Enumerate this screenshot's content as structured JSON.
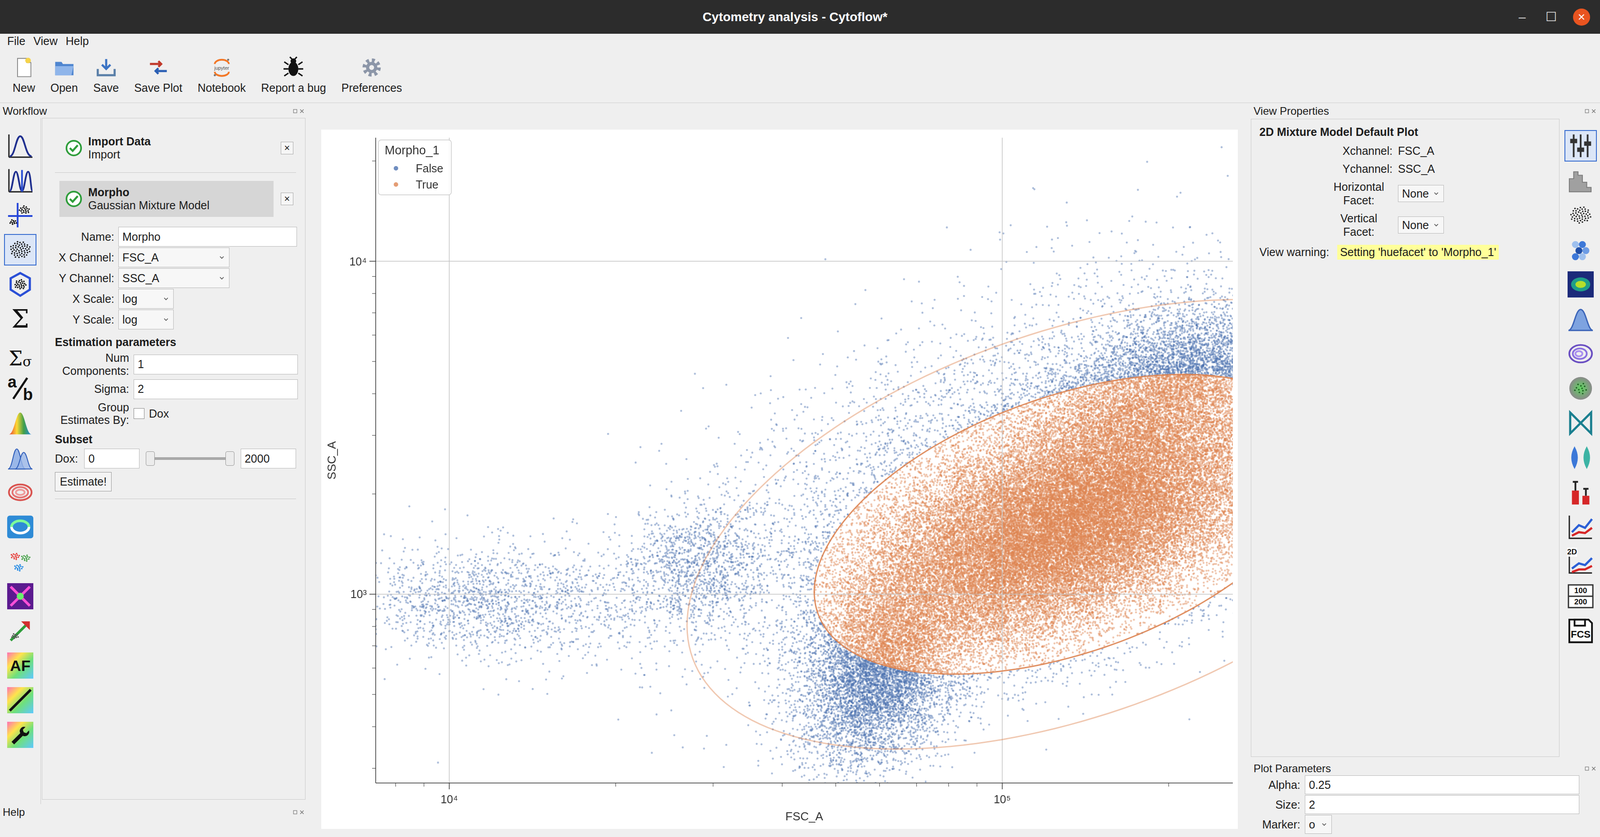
{
  "window": {
    "title": "Cytometry analysis - Cytoflow*",
    "controls": [
      "–",
      "☐",
      "×"
    ]
  },
  "menu": [
    "File",
    "View",
    "Help"
  ],
  "toolbar": [
    {
      "label": "New"
    },
    {
      "label": "Open"
    },
    {
      "label": "Save"
    },
    {
      "label": "Save Plot"
    },
    {
      "label": "Notebook",
      "icon_text": "jupyter"
    },
    {
      "label": "Report a bug"
    },
    {
      "label": "Preferences"
    }
  ],
  "workflow": {
    "title": "Workflow",
    "operations": [
      {
        "selected": false
      },
      {
        "selected": false
      },
      {
        "selected": false
      },
      {
        "selected": true
      },
      {
        "selected": false
      },
      {
        "selected": false,
        "label": "Σ"
      },
      {
        "selected": false,
        "label": "Σ",
        "sub": "σ"
      },
      {
        "selected": false,
        "label": "a",
        "sub": "b"
      },
      {
        "selected": false
      },
      {
        "selected": false
      },
      {
        "selected": false
      },
      {
        "selected": false
      },
      {
        "selected": false
      },
      {
        "selected": false
      },
      {
        "selected": false
      },
      {
        "selected": false,
        "label": "AF"
      },
      {
        "selected": false
      },
      {
        "selected": false
      }
    ],
    "steps": [
      {
        "name": "Import Data",
        "type": "Import",
        "valid": true,
        "selected": false,
        "close": "×"
      },
      {
        "name": "Morpho",
        "type": "Gaussian Mixture Model",
        "valid": true,
        "selected": true,
        "close": "×"
      }
    ],
    "form": {
      "fields": [
        {
          "label": "Name:",
          "value": "Morpho",
          "kind": "text"
        },
        {
          "label": "X Channel:",
          "value": "FSC_A",
          "kind": "select"
        },
        {
          "label": "Y Channel:",
          "value": "SSC_A",
          "kind": "select"
        },
        {
          "label": "X Scale:",
          "value": "log",
          "kind": "select"
        },
        {
          "label": "Y Scale:",
          "value": "log",
          "kind": "select"
        }
      ],
      "estimation": {
        "title": "Estimation parameters",
        "fields": [
          {
            "label": "Num Components:",
            "value": "1",
            "kind": "text"
          },
          {
            "label": "Sigma:",
            "value": "2",
            "kind": "text"
          },
          {
            "label": "Group Estimates By:",
            "kind": "checkbox",
            "options": [
              {
                "label": "Dox",
                "checked": false
              }
            ]
          }
        ]
      },
      "subset": {
        "title": "Subset",
        "ranges": [
          {
            "label": "Dox:",
            "low": "0",
            "high": "2000",
            "low_level": 0,
            "high_level": 1
          }
        ]
      },
      "button": "Estimate!"
    }
  },
  "help": {
    "title": "Help"
  },
  "plot": {
    "x_axis": {
      "label": "FSC_A",
      "scale": "log",
      "min": 3.867,
      "max": 5.417,
      "ticks": [
        {
          "value": 4,
          "label": "10⁴"
        },
        {
          "value": 5,
          "label": "10⁵"
        }
      ]
    },
    "y_axis": {
      "label": "SSC_A",
      "scale": "log",
      "min": 2.433,
      "max": 4.371,
      "ticks": [
        {
          "value": 3,
          "label": "10³"
        },
        {
          "value": 4,
          "label": "10⁴"
        }
      ]
    },
    "legend": {
      "title": "Morpho_1",
      "items": [
        {
          "label": "False",
          "color": "#4c72b0"
        },
        {
          "label": "True",
          "color": "#dd8452"
        }
      ]
    },
    "populations": [
      {
        "center": [
          5.12,
          3.21
        ],
        "sd": [
          0.19,
          0.19
        ],
        "rho": 0.55,
        "count": 42000
      },
      {
        "center": [
          5.3,
          3.62
        ],
        "sd": [
          0.12,
          0.13
        ],
        "rho": 0.5,
        "count": 7000
      },
      {
        "center": [
          4.78,
          2.78
        ],
        "sd": [
          0.07,
          0.15
        ],
        "rho": 0.3,
        "count": 7000
      },
      {
        "center": [
          4.92,
          3.45
        ],
        "sd": [
          0.28,
          0.3
        ],
        "rho": 0.7,
        "count": 3000
      },
      {
        "center": [
          4.45,
          3.08
        ],
        "sd": [
          0.07,
          0.1
        ],
        "rho": 0.2,
        "count": 1200
      },
      {
        "center": [
          4.08,
          2.98
        ],
        "sd": [
          0.13,
          0.085
        ],
        "rho": 0.0,
        "count": 1600
      }
    ],
    "gate": {
      "center": [
        5.12,
        3.21
      ],
      "sd": [
        0.23,
        0.225
      ],
      "rho": 0.45,
      "boundary": 2,
      "contours": [
        1,
        2,
        3
      ]
    }
  },
  "view_properties": {
    "dock_title": "View Properties",
    "title": "2D Mixture Model Default Plot",
    "fields": [
      {
        "label": "Xchannel:",
        "value": "FSC_A",
        "kind": "static"
      },
      {
        "label": "Ychannel:",
        "value": "SSC_A",
        "kind": "static"
      },
      {
        "label": "Horizontal Facet:",
        "value": "None",
        "kind": "select"
      },
      {
        "label": "Vertical Facet:",
        "value": "None",
        "kind": "select"
      }
    ],
    "warning": {
      "label": "View warning:",
      "text": "Setting 'huefacet' to 'Morpho_1'"
    },
    "views": [
      {
        "selected": true
      },
      {
        "selected": false
      },
      {
        "selected": false
      },
      {
        "selected": false
      },
      {
        "selected": false
      },
      {
        "selected": false
      },
      {
        "selected": false
      },
      {
        "selected": false
      },
      {
        "selected": false
      },
      {
        "selected": false
      },
      {
        "selected": false
      },
      {
        "selected": false
      },
      {
        "selected": false,
        "label": "2D"
      },
      {
        "selected": false,
        "labels": [
          "100",
          "200"
        ]
      },
      {
        "selected": false,
        "label": "FCS"
      }
    ]
  },
  "plot_parameters": {
    "title": "Plot Parameters",
    "fields": [
      {
        "label": "Alpha:",
        "value": "0.25",
        "kind": "text"
      },
      {
        "label": "Size:",
        "value": "2",
        "kind": "text"
      },
      {
        "label": "Marker:",
        "value": "o",
        "kind": "select"
      }
    ]
  }
}
